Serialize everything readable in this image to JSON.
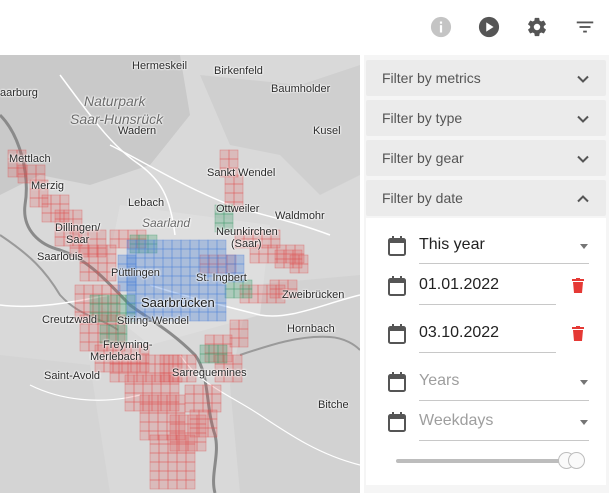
{
  "toolbar": {
    "icons": [
      "info-icon",
      "play-circle-icon",
      "gear-icon",
      "filter-list-icon"
    ],
    "icon_color": "#555555",
    "info_disabled_color": "#c0c0c0"
  },
  "map": {
    "labels": {
      "hermeskeil": "Hermeskeil",
      "birkenfeld": "Birkenfeld",
      "aarburg": "aarburg",
      "baumholder": "Baumholder",
      "naturpark1": "Naturpark",
      "naturpark2": "Saar-Hunsrück",
      "wadern": "Wadern",
      "kusel": "Kusel",
      "mettlach": "Mettlach",
      "sanktwendel": "Sankt Wendel",
      "merzig": "Merzig",
      "lebach": "Lebach",
      "ottweiler": "Ottweiler",
      "saarland": "Saarland",
      "waldmohr": "Waldmohr",
      "dillingen": "Dillingen/",
      "saar1": "Saar",
      "neunkirchen": "Neunkirchen",
      "saar2": "(Saar)",
      "saarlouis": "Saarlouis",
      "puettlingen": "Püttlingen",
      "stingbert": "St. Ingbert",
      "zweibruecken": "Zweibrücken",
      "saarbruecken": "Saarbrücken",
      "creutzwald": "Creutzwald",
      "stiringwendel": "Stiring-Wendel",
      "hornbach": "Hornbach",
      "freyming": "Freyming-",
      "merlebach": "Merlebach",
      "saintavold": "Saint-Avold",
      "sarreguemines": "Sarreguemines",
      "bitche": "Bitche"
    }
  },
  "filters": {
    "metrics": "Filter by metrics",
    "type": "Filter by type",
    "gear": "Filter by gear",
    "date": "Filter by date",
    "date_panel": {
      "period": "This year",
      "start_date": "01.01.2022",
      "end_date": "03.10.2022",
      "years_placeholder": "Years",
      "weekdays_placeholder": "Weekdays",
      "slider_range": [
        1.0,
        1.0
      ]
    }
  },
  "colors": {
    "tile_red": "#e05050",
    "tile_green": "#3a9a6a",
    "tile_blue": "#4a80d8",
    "delete_red": "#e53935"
  }
}
